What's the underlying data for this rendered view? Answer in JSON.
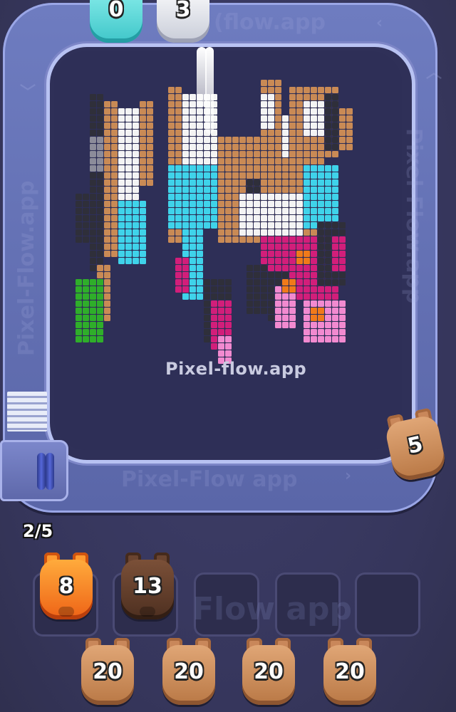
{
  "watermark_board": "Pixel-flow.app",
  "watermark_track": "Pixel-Flow.app",
  "watermark_track_top": "(flow.app",
  "watermark_track_bottom": "Pixel-Flow app",
  "watermark_dock": "Flow app",
  "queue_counter": "2/5",
  "top_pigs": [
    {
      "count": "0",
      "color": "cyan"
    },
    {
      "count": "3",
      "color": "white"
    }
  ],
  "conveyor_pig": {
    "count": "5",
    "color": "brown"
  },
  "dock_pigs": [
    {
      "count": "8",
      "color": "orange"
    },
    {
      "count": "13",
      "color": "dark-brown"
    }
  ],
  "empty_slots": 3,
  "waiting_pigs": [
    {
      "count": "20",
      "color": "brown"
    },
    {
      "count": "20",
      "color": "brown"
    },
    {
      "count": "20",
      "color": "brown"
    },
    {
      "count": "20",
      "color": "brown"
    }
  ],
  "palette": {
    "track": "#6e7cc0",
    "board": "#2e2f57",
    "pixel_brown": "#c98a55",
    "pixel_white": "#f4f4f4",
    "pixel_cyan": "#3fd3ea",
    "pixel_magenta": "#d21e7a",
    "pixel_pink": "#f28ad0",
    "pixel_orange": "#f07a1a",
    "pixel_green": "#2fae2a",
    "pixel_dark": "#2f2f3a",
    "pixel_gray": "#8c8c9a"
  }
}
